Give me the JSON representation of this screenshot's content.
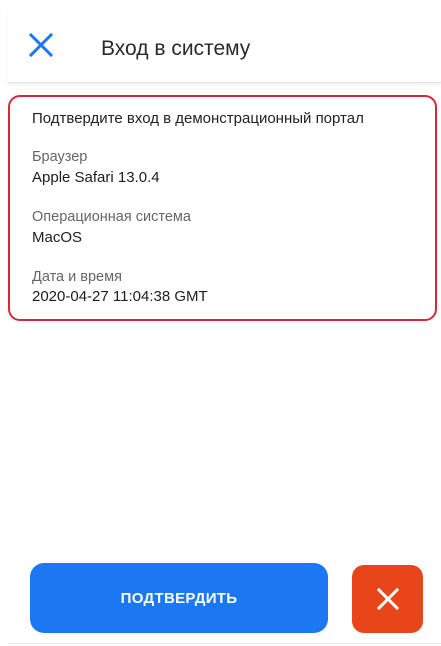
{
  "colors": {
    "accent": "#1b78f2",
    "reject": "#e8451a",
    "highlight_border": "#d6283a"
  },
  "appbar": {
    "title": "Вход в систему",
    "close_icon": "close-icon"
  },
  "card": {
    "heading": "Подтвердите вход в демонстрационный портал",
    "fields": [
      {
        "label": "Браузер",
        "value": "Apple Safari 13.0.4"
      },
      {
        "label": "Операционная система",
        "value": "MacOS"
      },
      {
        "label": "Дата и время",
        "value": "2020-04-27 11:04:38 GMT"
      }
    ]
  },
  "actions": {
    "confirm_label": "ПОДТВЕРДИТЬ",
    "reject_icon": "close-icon"
  }
}
